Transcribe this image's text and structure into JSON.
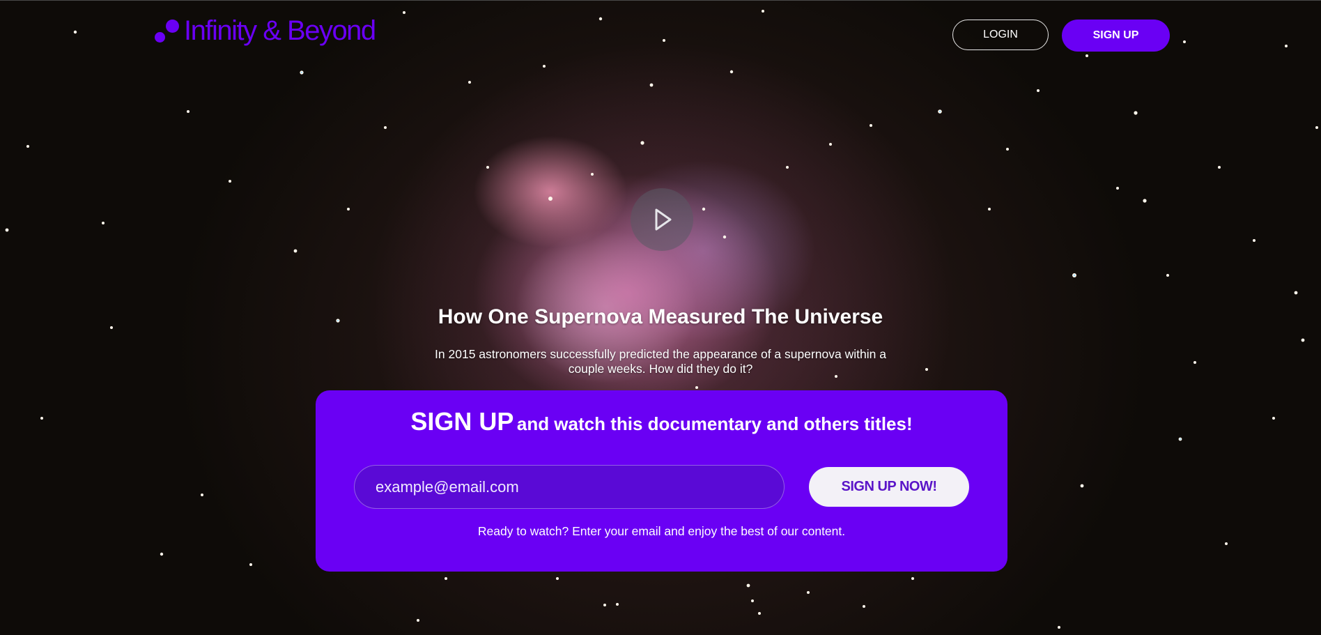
{
  "header": {
    "brand": "Infinity & Beyond",
    "login_label": "LOGIN",
    "signup_label": "SIGN UP"
  },
  "hero": {
    "title": "How One Supernova Measured The Universe",
    "description": "In 2015 astronomers successfully predicted the appearance of a supernova within a couple weeks. How did they do it?"
  },
  "signup_card": {
    "headline_strong": "SIGN UP",
    "headline_rest": "and watch this documentary and others titles!",
    "email_placeholder": "example@email.com",
    "button_label": "SIGN UP NOW!",
    "note": "Ready to watch? Enter your email and enjoy the best of our content."
  },
  "colors": {
    "accent": "#6a00f4",
    "button_light": "#f3f1f7",
    "background": "#0e0b08"
  },
  "icons": {
    "play": "play-icon",
    "logo": "logo-dots-icon"
  }
}
